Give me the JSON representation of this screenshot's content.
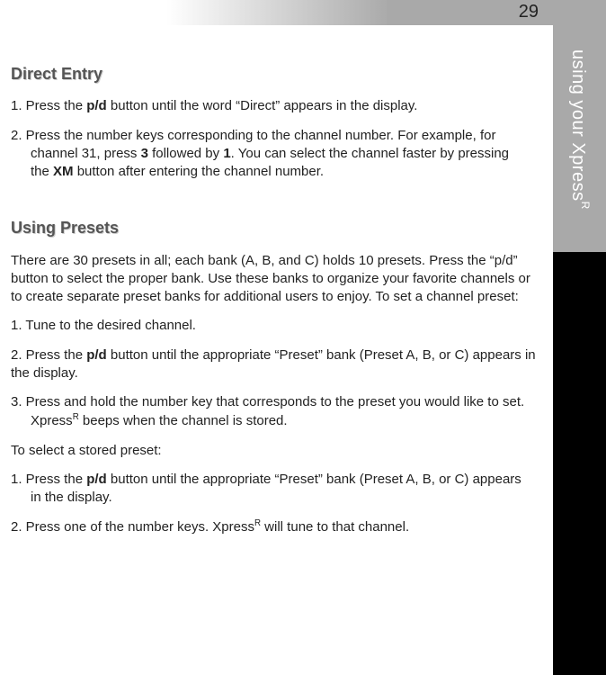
{
  "page_number": "29",
  "side_tab": "using your XpressR",
  "side_tab_base": "using your Xpress",
  "side_tab_sup": "R",
  "sections": {
    "direct_entry": {
      "heading": "Direct Entry",
      "step1_lead": "1. Press the ",
      "step1_b1": "p/d",
      "step1_tail": " button until the word “Direct” appears in the display.",
      "step2_lead": "2. Press the number keys corresponding to the channel number. For example, for",
      "step2_indent_a": "channel 31, press ",
      "step2_b1": "3",
      "step2_mid": " followed by ",
      "step2_b2": "1",
      "step2_tail": ". You can select the channel faster by pressing",
      "step2_indent_b_lead": "the ",
      "step2_b3": "XM",
      "step2_indent_b_tail": " button after entering the channel number."
    },
    "using_presets": {
      "heading": "Using Presets",
      "intro": "There are 30 presets in all; each bank (A, B, and C) holds 10 presets. Press the “p/d” button to select the proper bank. Use these banks to organize your favorite channels or to create separate preset banks for additional users to enjoy.  To set a channel preset:",
      "set1": "1. Tune to the desired channel.",
      "set2_lead": "2. Press the ",
      "set2_b1": "p/d",
      "set2_tail": " button until the appropriate “Preset” bank (Preset A, B, or C) appears in the display.",
      "set3_line1": "3. Press and hold the number key that corresponds to the preset you would like to set.",
      "set3_indent_a": "Xpress",
      "set3_sup": "R",
      "set3_indent_b": " beeps when the channel is stored.",
      "select_intro": "To select a stored preset:",
      "sel1_lead": "1. Press the ",
      "sel1_b1": "p/d",
      "sel1_line1_tail": " button until the appropriate “Preset” bank (Preset A, B, or C) appears",
      "sel1_indent": "in the display.",
      "sel2_a": "2. Press one of the number keys. Xpress",
      "sel2_sup": "R",
      "sel2_b": " will tune to that channel."
    }
  }
}
